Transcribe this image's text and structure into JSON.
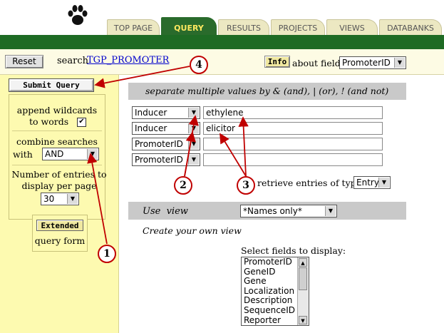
{
  "nav": {
    "tabs": [
      {
        "label": "TOP PAGE",
        "active": false
      },
      {
        "label": "QUERY",
        "active": true
      },
      {
        "label": "RESULTS",
        "active": false
      },
      {
        "label": "PROJECTS",
        "active": false
      },
      {
        "label": "VIEWS",
        "active": false
      },
      {
        "label": "DATABANKS",
        "active": false
      }
    ]
  },
  "toolbar": {
    "reset_label": "Reset",
    "search_label": "search",
    "db_link": "TGP_PROMOTER",
    "info_label": "Info",
    "about_field_label": "about field",
    "about_field_value": "PromoterID"
  },
  "sidebar": {
    "submit_label": "Submit Query",
    "append_wildcards_line1": "append wildcards",
    "append_wildcards_line2": "to words",
    "append_wildcards_checked": true,
    "combine_line1": "combine searches",
    "combine_with": "with",
    "combine_value": "AND",
    "entries_line1": "Number of entries to",
    "entries_line2": "display per page",
    "entries_value": "30",
    "extended_label": "Extended",
    "query_form_label": "query form"
  },
  "query": {
    "hint": "separate multiple values by & (and), | (or), ! (and not)",
    "rows": [
      {
        "field": "Inducer",
        "value": "ethylene"
      },
      {
        "field": "Inducer",
        "value": "elicitor"
      },
      {
        "field": "PromoterID",
        "value": ""
      },
      {
        "field": "PromoterID",
        "value": ""
      }
    ],
    "retrieve_label": "retrieve entries of type",
    "retrieve_value": "Entry"
  },
  "view": {
    "use_view_label": "Use  view",
    "view_value": "*Names only*",
    "create_label": "Create your own view",
    "fields_label": "Select fields to display:",
    "fields": [
      "PromoterID",
      "GeneID",
      "Gene",
      "Localization",
      "Description",
      "SequenceID",
      "Reporter"
    ]
  },
  "callouts": [
    "1",
    "2",
    "3",
    "4"
  ],
  "colors": {
    "nav_green": "#1e6b24",
    "tab_active_text": "#ffe860",
    "sidebar_bg": "#fdfab0",
    "callout_red": "#c00000"
  },
  "icons": {
    "logo": "paw-print-icon",
    "dropdown": "chevron-down-icon",
    "checkbox": "checkmark-icon"
  }
}
